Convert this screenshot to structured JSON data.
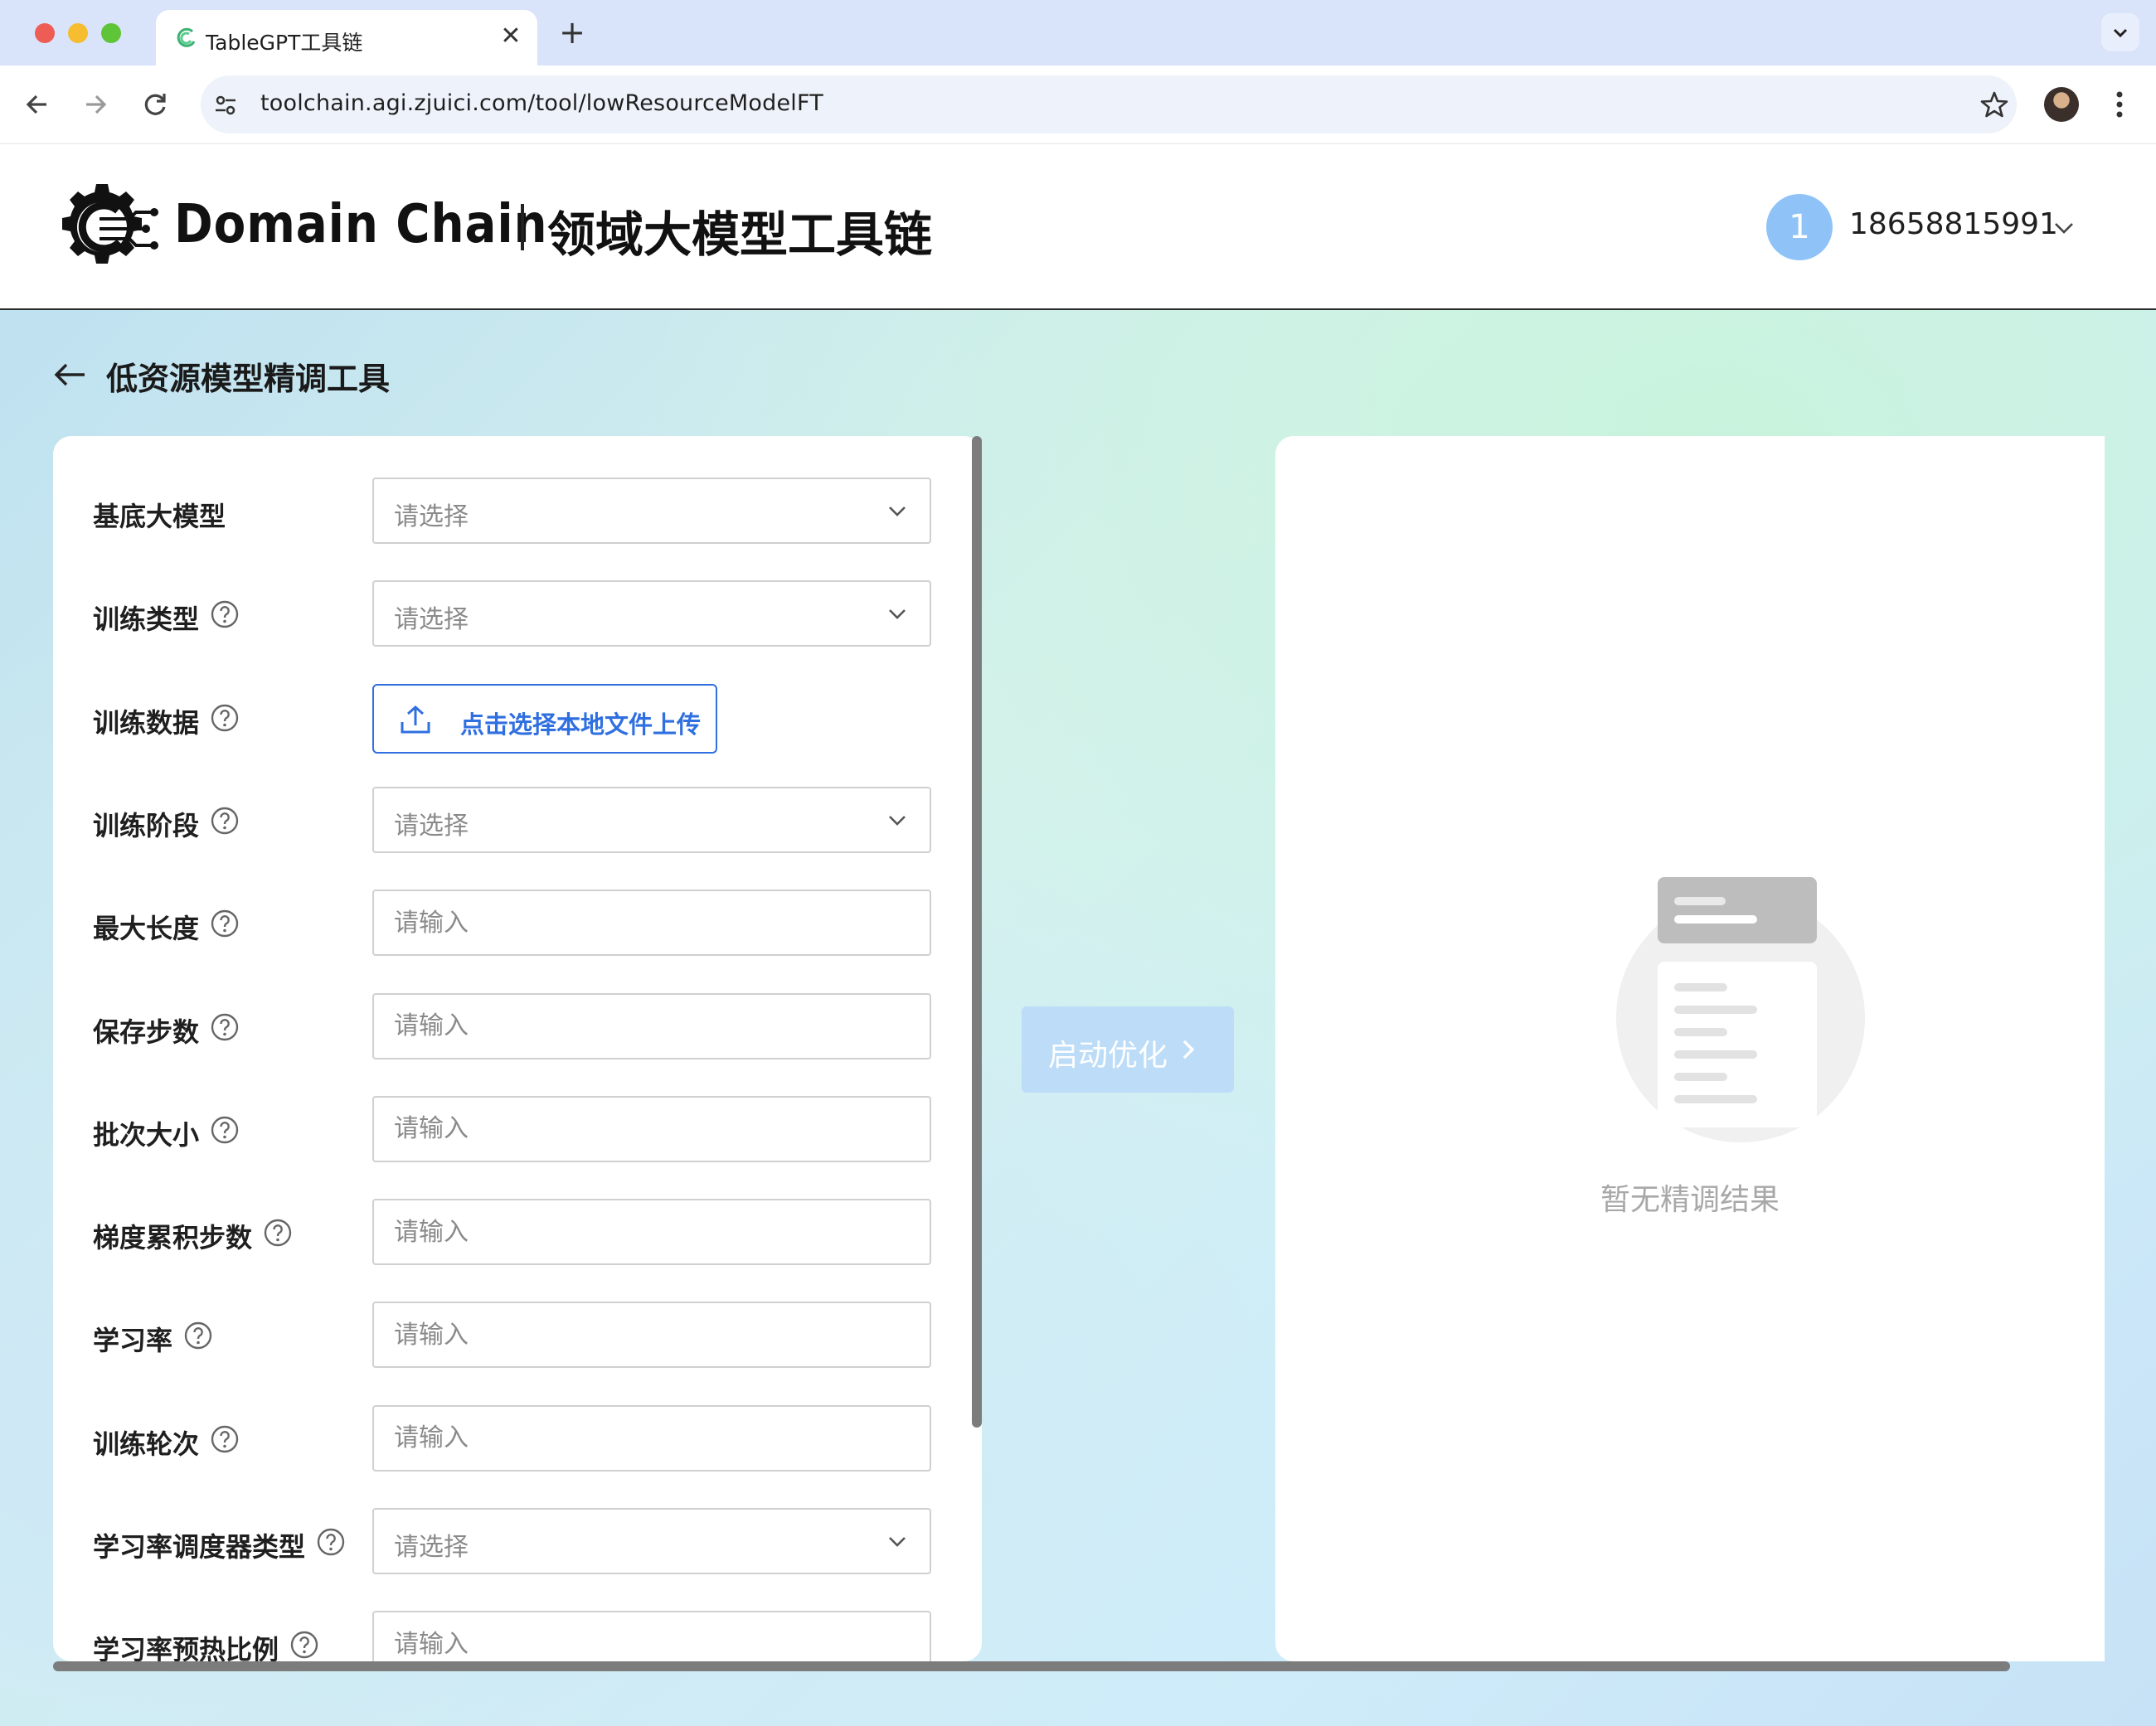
{
  "browser": {
    "tab_title": "TableGPT工具链",
    "new_tab_symbol": "+",
    "close_symbol": "✕",
    "url": "toolchain.agi.zjuici.com/tool/lowResourceModelFT"
  },
  "header": {
    "brand": "Domain Chain",
    "brand_cn": "领域大模型工具链",
    "user": {
      "avatar_text": "1",
      "name": "18658815991"
    }
  },
  "page": {
    "title": "低资源模型精调工具"
  },
  "form": {
    "fields": [
      {
        "label": "基底大模型",
        "type": "select",
        "placeholder": "请选择",
        "help": false
      },
      {
        "label": "训练类型",
        "type": "select",
        "placeholder": "请选择",
        "help": true
      },
      {
        "label": "训练数据",
        "type": "upload",
        "button_label": "点击选择本地文件上传",
        "help": true
      },
      {
        "label": "训练阶段",
        "type": "select",
        "placeholder": "请选择",
        "help": true
      },
      {
        "label": "最大长度",
        "type": "input",
        "placeholder": "请输入",
        "help": true
      },
      {
        "label": "保存步数",
        "type": "input",
        "placeholder": "请输入",
        "help": true
      },
      {
        "label": "批次大小",
        "type": "input",
        "placeholder": "请输入",
        "help": true
      },
      {
        "label": "梯度累积步数",
        "type": "input",
        "placeholder": "请输入",
        "help": true
      },
      {
        "label": "学习率",
        "type": "input",
        "placeholder": "请输入",
        "help": true
      },
      {
        "label": "训练轮次",
        "type": "input",
        "placeholder": "请输入",
        "help": true
      },
      {
        "label": "学习率调度器类型",
        "type": "select",
        "placeholder": "请选择",
        "help": true
      },
      {
        "label": "学习率预热比例",
        "type": "input",
        "placeholder": "请输入",
        "help": true
      }
    ]
  },
  "actions": {
    "start_label": "启动优化"
  },
  "result": {
    "empty_text": "暂无精调结果"
  },
  "colors": {
    "accent": "#2f6fe0",
    "start_disabled": "#bcdcf7",
    "avatar": "#8fc3f7"
  }
}
